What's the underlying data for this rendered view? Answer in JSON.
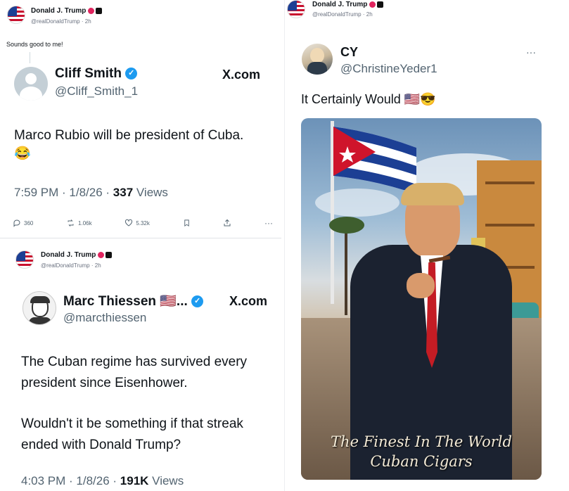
{
  "post1": {
    "name": "Donald J. Trump",
    "handle_time": "@realDonaldTrump · 2h",
    "caption": "Sounds good to me!",
    "quote": {
      "name": "Cliff Smith",
      "handle": "@Cliff_Smith_1",
      "source": "X.com",
      "text": "Marco Rubio will be president of Cuba. 😂",
      "time": "7:59 PM · 1/8/26 · ",
      "views_count": "337",
      "views_label": " Views",
      "replies": "360",
      "reposts": "1.06k",
      "likes": "5.32k"
    }
  },
  "post2": {
    "name": "Donald J. Trump",
    "handle_time": "@realDonaldTrump · 2h",
    "quote": {
      "name": "Marc Thiessen 🇺🇸...",
      "handle": "@marcthiessen",
      "source": "X.com",
      "text1": "The Cuban regime has survived every president since Eisenhower.",
      "text2": "Wouldn't it be something if that streak ended with Donald Trump?",
      "time": "4:03 PM · 1/8/26 · ",
      "views_count": "191K",
      "views_label": " Views"
    }
  },
  "post3": {
    "name": "Donald J. Trump",
    "handle_time": "@realDonaldTrump · 2h",
    "quote": {
      "name": "CY",
      "handle": "@ChristineYeder1",
      "text": "It Certainly Would 🇺🇸😎",
      "more": "···",
      "image_caption_line1": "The Finest In The World",
      "image_caption_line2": "Cuban Cigars"
    }
  },
  "icons": [
    "reply-icon",
    "repost-icon",
    "like-icon",
    "bookmark-icon",
    "share-icon",
    "more-icon"
  ],
  "colors": {
    "verified": "#1d9bf0",
    "badge_red": "#e0245e",
    "muted": "#536471"
  }
}
